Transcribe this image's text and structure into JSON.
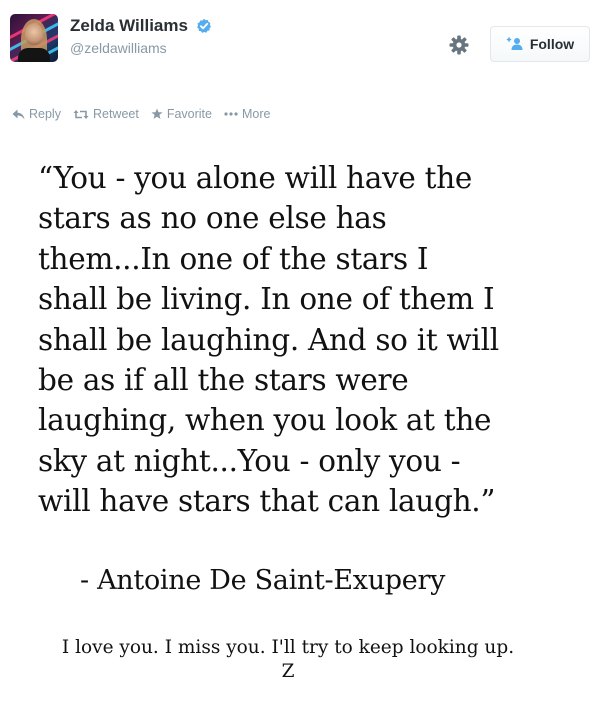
{
  "profile": {
    "display_name": "Zelda Williams",
    "handle": "@zeldawilliams",
    "verified": true
  },
  "header_actions": {
    "settings_icon": "gear-icon",
    "follow_label": "Follow",
    "follow_icon": "add-user-icon"
  },
  "tweet_actions": {
    "reply": "Reply",
    "retweet": "Retweet",
    "favorite": "Favorite",
    "more": "More"
  },
  "quote": {
    "lines": [
      "“You - you alone will have the",
      "stars as no one else has",
      "them...In one of the stars I",
      "shall be living. In one of them I",
      "shall be laughing. And so it will",
      "be as if all the stars were",
      "laughing, when you look at the",
      "sky at night...You - only you -",
      "will have stars that can laugh.”"
    ],
    "attribution": "- Antoine De Saint-Exupery"
  },
  "message": {
    "line1": "I love you. I miss you. I'll try to keep looking up.",
    "signature": "Z"
  },
  "colors": {
    "text_primary": "#292f33",
    "text_muted": "#8899a6",
    "verified_blue": "#55acee",
    "follow_icon_blue": "#55acee"
  }
}
